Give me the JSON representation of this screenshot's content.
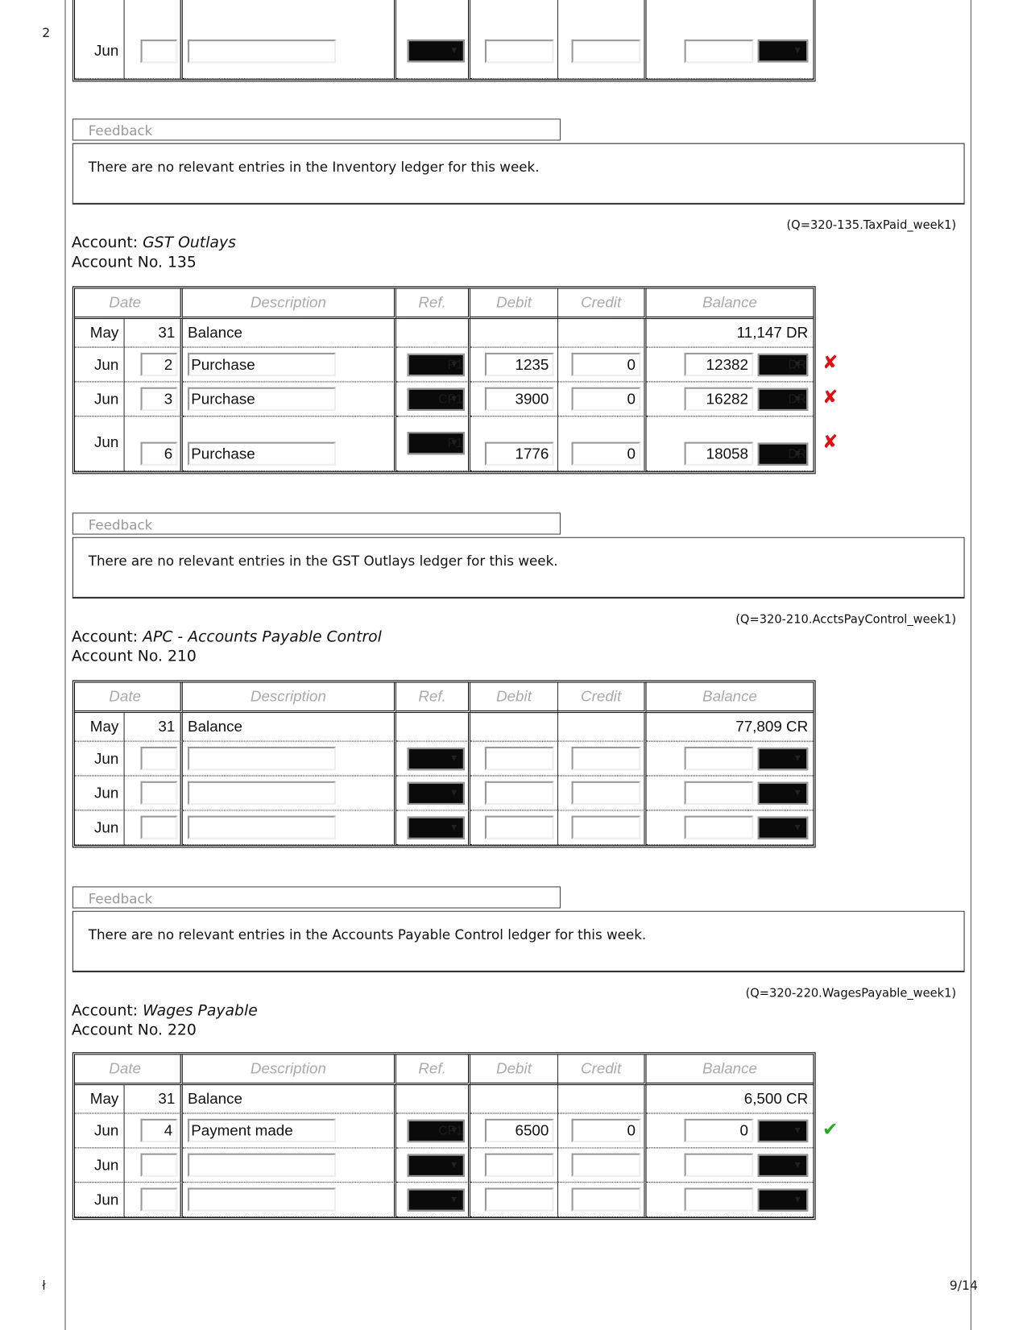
{
  "margin": {
    "top_num": "2",
    "bottom_char": "ł",
    "page": "9/14"
  },
  "headers": {
    "date": "Date",
    "description": "Description",
    "ref": "Ref.",
    "debit": "Debit",
    "credit": "Credit",
    "balance": "Balance"
  },
  "feedback_label": "Feedback",
  "inventory": {
    "rows": [
      {
        "month": "Jun",
        "day": "",
        "desc": "",
        "ref": "",
        "debit": "",
        "credit": "",
        "balance": "",
        "side": ""
      }
    ],
    "feedback": "There are no relevant entries in the Inventory ledger for this week."
  },
  "ledgers": [
    {
      "q": "(Q=320-135.TaxPaid_week1)",
      "label": "Account:",
      "name": "GST Outlays",
      "number": "Account No. 135",
      "opening": {
        "month": "May",
        "day": "31",
        "desc": "Balance",
        "balance": "11,147 DR"
      },
      "rows": [
        {
          "month": "Jun",
          "day": "2",
          "desc": "Purchase",
          "ref": "P1",
          "debit": "1235",
          "credit": "0",
          "balance": "12382",
          "side": "DR",
          "mark": "incorrect"
        },
        {
          "month": "Jun",
          "day": "3",
          "desc": "Purchase",
          "ref": "CP1",
          "debit": "3900",
          "credit": "0",
          "balance": "16282",
          "side": "DR",
          "mark": "incorrect"
        },
        {
          "month": "Jun",
          "day": "6",
          "desc": "Purchase",
          "ref": "P1",
          "debit": "1776",
          "credit": "0",
          "balance": "18058",
          "side": "DR",
          "mark": "incorrect",
          "tall": true
        }
      ],
      "feedback": "There are no relevant entries in the GST Outlays ledger for this week."
    },
    {
      "q": "(Q=320-210.AcctsPayControl_week1)",
      "label": "Account:",
      "name": "APC - Accounts Payable Control",
      "number": "Account No. 210",
      "opening": {
        "month": "May",
        "day": "31",
        "desc": "Balance",
        "balance": "77,809 CR"
      },
      "rows": [
        {
          "month": "Jun",
          "day": "",
          "desc": "",
          "ref": "",
          "debit": "",
          "credit": "",
          "balance": "",
          "side": ""
        },
        {
          "month": "Jun",
          "day": "",
          "desc": "",
          "ref": "",
          "debit": "",
          "credit": "",
          "balance": "",
          "side": ""
        },
        {
          "month": "Jun",
          "day": "",
          "desc": "",
          "ref": "",
          "debit": "",
          "credit": "",
          "balance": "",
          "side": ""
        }
      ],
      "feedback": "There are no relevant entries in the Accounts Payable Control ledger for this week."
    },
    {
      "q": "(Q=320-220.WagesPayable_week1)",
      "label": "Account:",
      "name": "Wages Payable",
      "number": "Account No. 220",
      "opening": {
        "month": "May",
        "day": "31",
        "desc": "Balance",
        "balance": "6,500 CR"
      },
      "rows": [
        {
          "month": "Jun",
          "day": "4",
          "desc": "Payment made",
          "ref": "CP1",
          "debit": "6500",
          "credit": "0",
          "balance": "0",
          "side": "",
          "mark": "correct"
        },
        {
          "month": "Jun",
          "day": "",
          "desc": "",
          "ref": "",
          "debit": "",
          "credit": "",
          "balance": "",
          "side": ""
        },
        {
          "month": "Jun",
          "day": "",
          "desc": "",
          "ref": "",
          "debit": "",
          "credit": "",
          "balance": "",
          "side": ""
        }
      ]
    }
  ],
  "colors": {
    "incorrect": "#e01010",
    "correct": "#22aa22"
  }
}
